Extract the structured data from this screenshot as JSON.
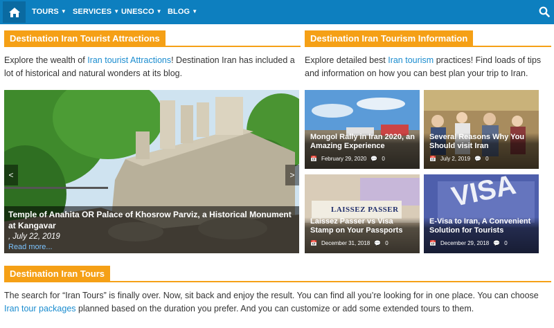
{
  "nav": {
    "items": [
      {
        "label": "TOURS"
      },
      {
        "label": "SERVICES"
      },
      {
        "label": "UNESCO"
      },
      {
        "label": "BLOG"
      }
    ],
    "bar_color": "#0d7fbf",
    "accent_color": "#f5a016"
  },
  "attractions": {
    "heading": "Destination Iran Tourist Attractions",
    "intro_before": "Explore the wealth of ",
    "intro_link": "Iran tourist Attractions",
    "intro_after": "! Destination Iran has included a lot of historical and natural wonders at its blog.",
    "feature": {
      "title": "Temple of Anahita OR Palace of Khosrow Parviz, a Historical Monument at Kangavar",
      "date": ", July 22, 2019",
      "read_more": "Read more..."
    }
  },
  "information": {
    "heading": "Destination Iran Tourism Information",
    "intro_before": "Explore detailed best ",
    "intro_link": "Iran tourism",
    "intro_after": " practices! Find loads of tips and information on how you can best plan your trip to Iran.",
    "cards": [
      {
        "title": "Mongol Rally in Iran 2020, an Amazing Experience",
        "date": "February 29, 2020",
        "comments": "0"
      },
      {
        "title": "Several Reasons Why You Should visit Iran",
        "date": "July 2, 2019",
        "comments": "0"
      },
      {
        "title": "Laissez Passer vs Visa Stamp on Your Passports",
        "date": "December 31, 2018",
        "comments": "0"
      },
      {
        "title": "E-Visa to Iran, A Convenient Solution for Tourists",
        "date": "December 29, 2018",
        "comments": "0"
      }
    ],
    "image_text": {
      "laissez": "LAISSEZ PASSER",
      "visa": "VISA"
    }
  },
  "tours": {
    "heading": "Destination Iran Tours",
    "text_before": "The search for “Iran Tours” is finally over. Now, sit back and enjoy the result. You can find all you’re looking for in one place. You can choose ",
    "text_link": "Iran tour packages",
    "text_after": " planned based on the duration you prefer. And you can customize or add some extended tours to them."
  }
}
